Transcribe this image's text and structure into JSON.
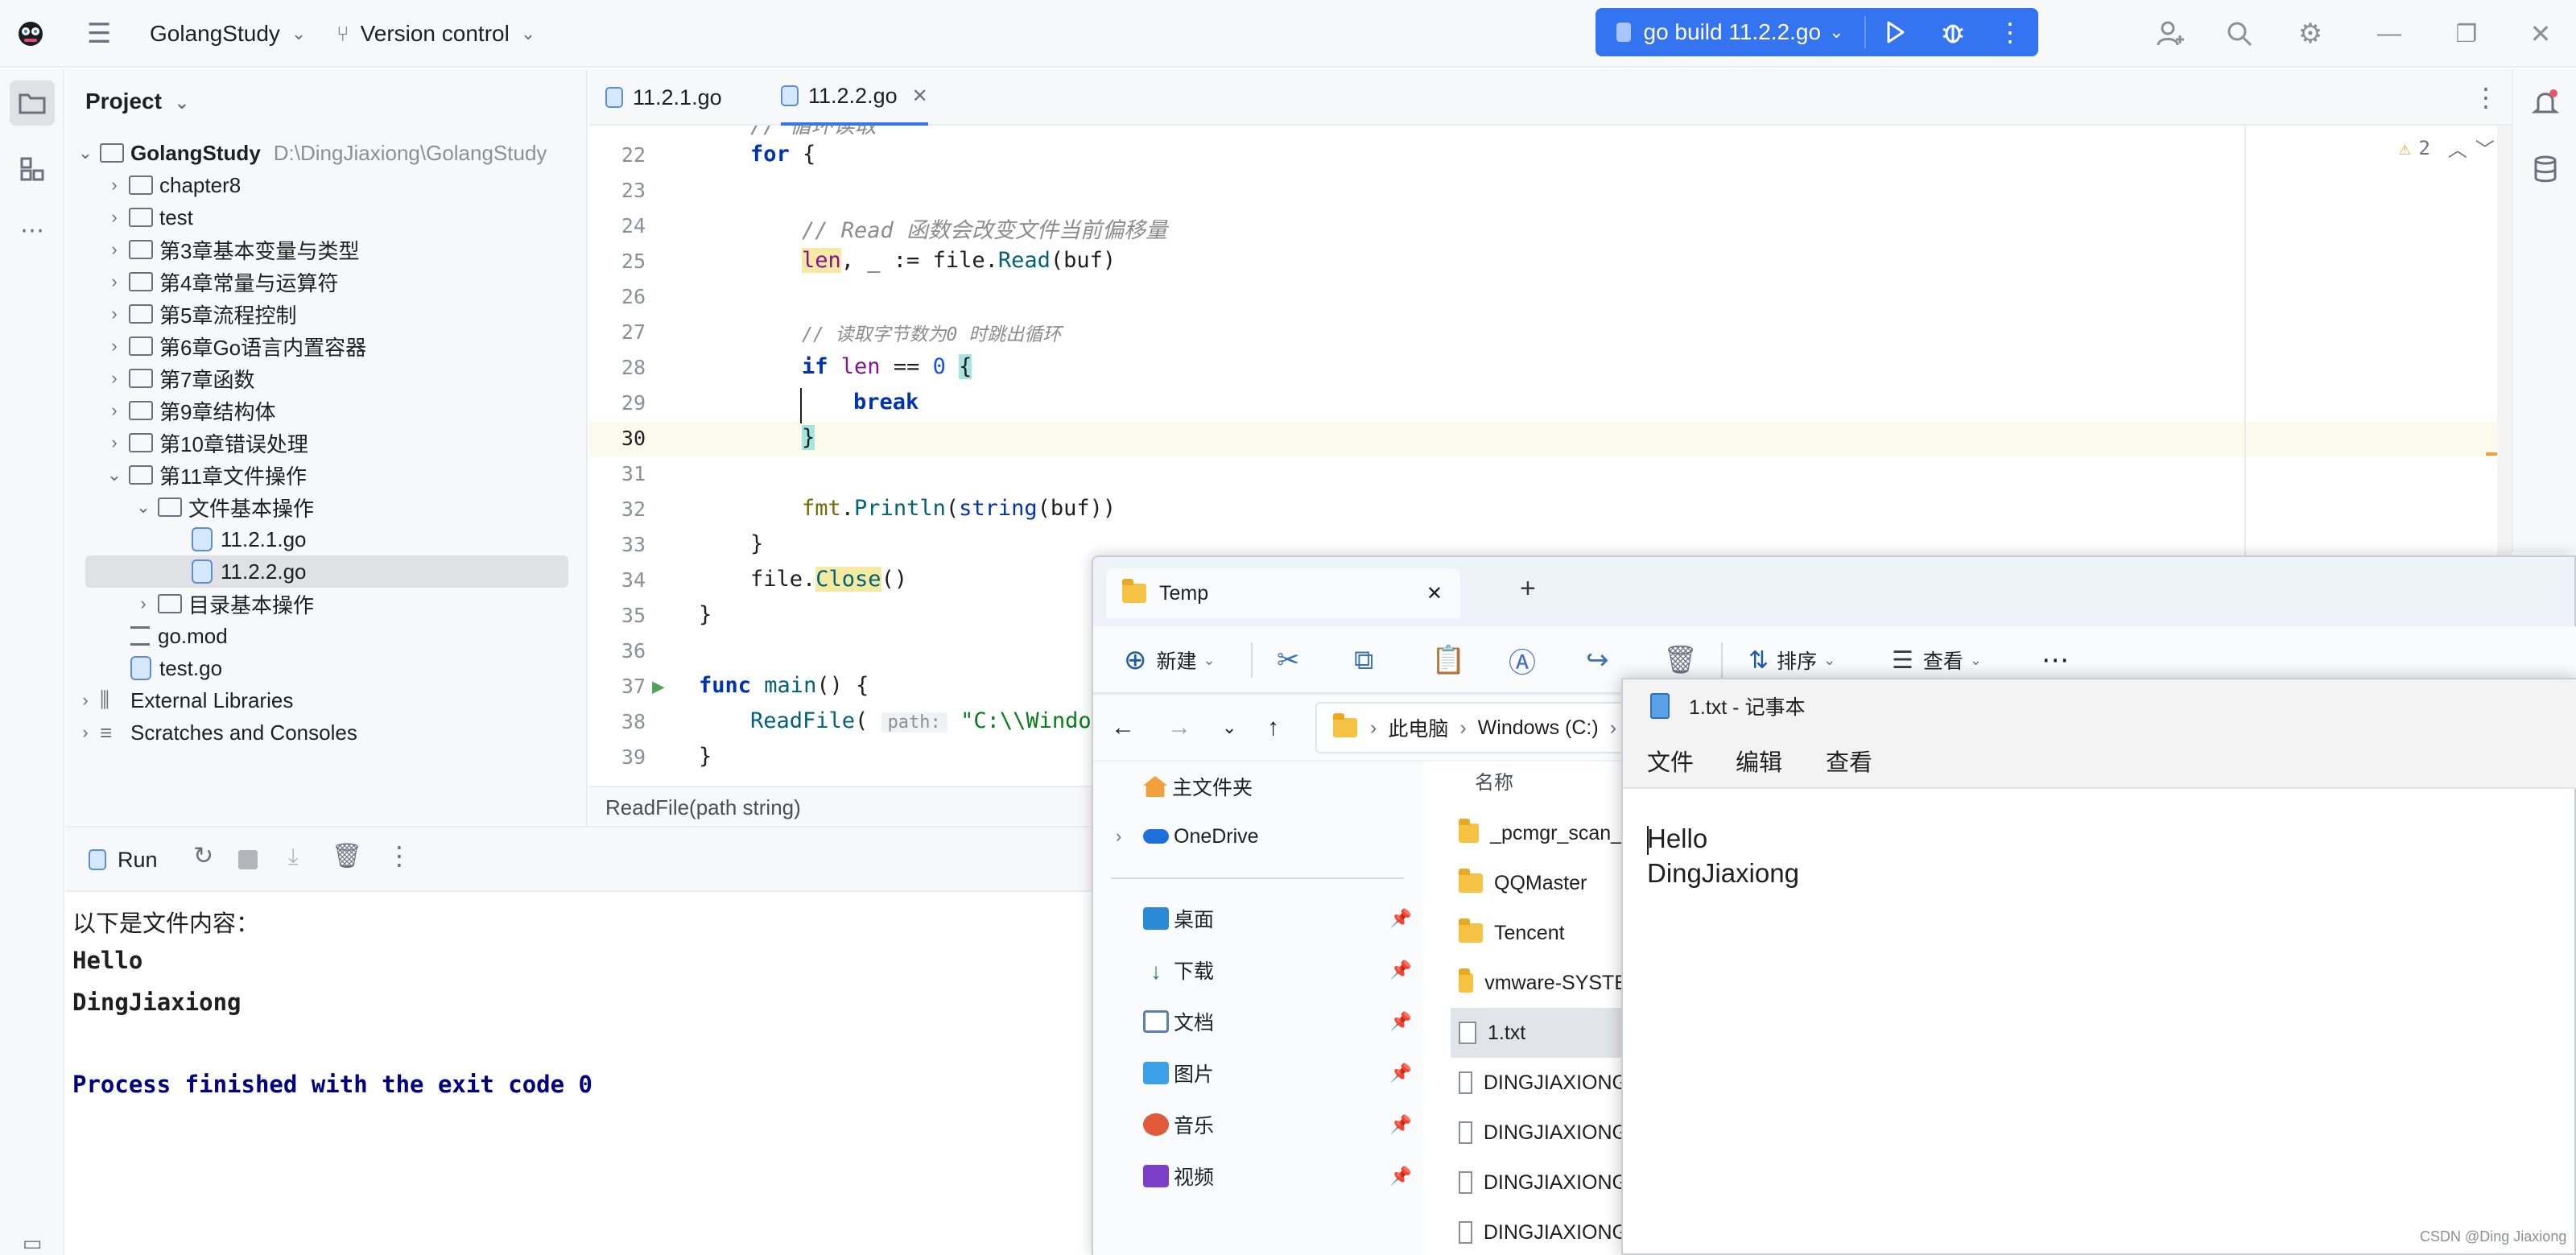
{
  "titlebar": {
    "project_name": "GolangStudy",
    "vcs": "Version control",
    "run_config": "go build 11.2.2.go"
  },
  "project_panel": {
    "title": "Project",
    "root": {
      "name": "GolangStudy",
      "path": "D:\\DingJiaxiong\\GolangStudy"
    },
    "items": [
      {
        "label": "chapter8"
      },
      {
        "label": "test"
      },
      {
        "label": "第3章基本变量与类型"
      },
      {
        "label": "第4章常量与运算符"
      },
      {
        "label": "第5章流程控制"
      },
      {
        "label": "第6章Go语言内置容器"
      },
      {
        "label": "第7章函数"
      },
      {
        "label": "第9章结构体"
      },
      {
        "label": "第10章错误处理"
      },
      {
        "label": "第11章文件操作"
      },
      {
        "label": "文件基本操作"
      },
      {
        "label": "11.2.1.go"
      },
      {
        "label": "11.2.2.go"
      },
      {
        "label": "目录基本操作"
      },
      {
        "label": "go.mod"
      },
      {
        "label": "test.go"
      },
      {
        "label": "External Libraries"
      },
      {
        "label": "Scratches and Consoles"
      }
    ]
  },
  "editor": {
    "tabs": [
      {
        "label": "11.2.1.go"
      },
      {
        "label": "11.2.2.go"
      }
    ],
    "warnings": "2",
    "line_numbers": [
      "22",
      "23",
      "24",
      "25",
      "26",
      "27",
      "28",
      "29",
      "30",
      "31",
      "32",
      "33",
      "34",
      "35",
      "36",
      "37",
      "38",
      "39"
    ],
    "comment_read": "// Read 函数会改变文件当前偏移量",
    "comment_len": "// 读取字节数为0 时跳出循环",
    "param_hint": "path:",
    "string_partial": "\"C:\\\\Windows",
    "signature": "ReadFile(path string)"
  },
  "run_panel": {
    "tab_label": "Run",
    "output": [
      "以下是文件内容：",
      "Hello",
      "DingJiaxiong",
      "",
      "Process finished with the exit code 0"
    ]
  },
  "explorer": {
    "tab_title": "Temp",
    "toolbar": {
      "new": "新建",
      "sort": "排序",
      "view": "查看"
    },
    "address": [
      "此电脑",
      "Windows (C:)"
    ],
    "nav": [
      {
        "label": "主文件夹",
        "pinned": false
      },
      {
        "label": "OneDrive",
        "pinned": false
      },
      {
        "label": "桌面",
        "pinned": true
      },
      {
        "label": "下载",
        "pinned": true
      },
      {
        "label": "文档",
        "pinned": true
      },
      {
        "label": "图片",
        "pinned": true
      },
      {
        "label": "音乐",
        "pinned": true
      },
      {
        "label": "视频",
        "pinned": true
      }
    ],
    "column_header": "名称",
    "files": [
      {
        "name": "_pcmgr_scan_t",
        "type": "folder"
      },
      {
        "name": "QQMaster",
        "type": "folder"
      },
      {
        "name": "Tencent",
        "type": "folder"
      },
      {
        "name": "vmware-SYSTE",
        "type": "folder"
      },
      {
        "name": "1.txt",
        "type": "file"
      },
      {
        "name": "DINGJIAXIONG",
        "type": "file"
      },
      {
        "name": "DINGJIAXIONG",
        "type": "file"
      },
      {
        "name": "DINGJIAXIONG",
        "type": "file"
      },
      {
        "name": "DINGJIAXIONG",
        "type": "file"
      }
    ]
  },
  "notepad": {
    "title": "1.txt - 记事本",
    "menu": {
      "file": "文件",
      "edit": "编辑",
      "view": "查看"
    },
    "content": [
      "Hello",
      "DingJiaxiong"
    ]
  },
  "watermark": "CSDN @Ding Jiaxiong",
  "colors": {
    "accent": "#3574f0",
    "keyword": "#0033b3",
    "comment": "#8c8c8c",
    "output_finish": "#000080"
  }
}
